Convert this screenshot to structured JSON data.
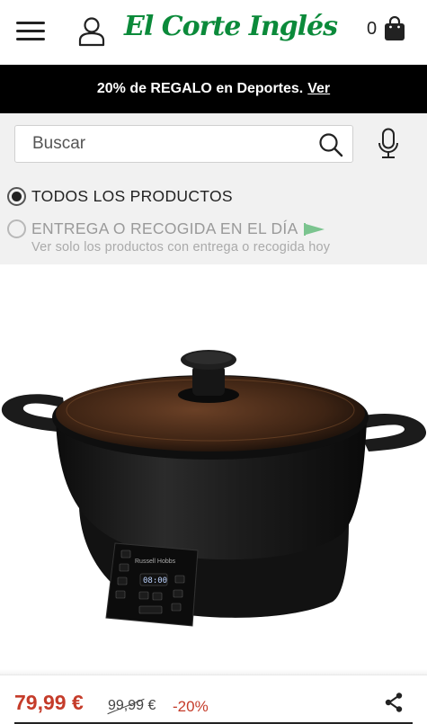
{
  "header": {
    "logo_text": "El Corte Inglés",
    "cart_count": "0",
    "icons": [
      "menu-icon",
      "user-icon",
      "shopping-bag-icon"
    ]
  },
  "promo": {
    "text": "20% de REGALO en Deportes.",
    "link": "Ver"
  },
  "search": {
    "placeholder": "Buscar"
  },
  "filters": {
    "all_products": "TODOS LOS PRODUCTOS",
    "same_day": "ENTREGA O RECOGIDA EN EL DÍA",
    "same_day_sub": "Ver solo los productos con entrega o recogida hoy",
    "selected": "all_products"
  },
  "product": {
    "brand_on_device": "Russell Hobbs",
    "display": "08:00",
    "price": "79,99 €",
    "old_price": "99,99 €",
    "discount": "-20%"
  },
  "colors": {
    "brand_green": "#0b8a3a",
    "price_red": "#c53c2a",
    "promo_bg": "#000000",
    "filter_bg": "#f1f1f1"
  }
}
